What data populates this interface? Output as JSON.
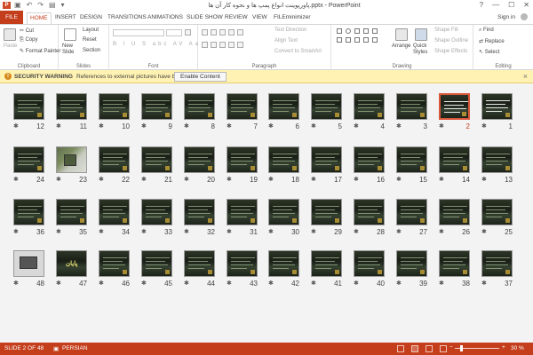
{
  "window": {
    "title": "پاورپوینت انواع پمپ ها و نحوه کار آن ها.pptx - PowerPoint",
    "app_icon": "P",
    "controls": [
      "?",
      "—",
      "☐",
      "✕"
    ]
  },
  "tabs": {
    "file": "FILE",
    "items": [
      "HOME",
      "INSERT",
      "DESIGN",
      "TRANSITIONS",
      "ANIMATIONS",
      "SLIDE SHOW",
      "REVIEW",
      "VIEW",
      "FILEminimizer"
    ],
    "active": "HOME",
    "signin": "Sign in"
  },
  "ribbon": {
    "clipboard": {
      "label": "Clipboard",
      "paste": "Paste",
      "cut": "Cut",
      "copy": "Copy",
      "format_painter": "Format Painter"
    },
    "slides": {
      "label": "Slides",
      "new_slide": "New Slide",
      "layout": "Layout",
      "reset": "Reset",
      "section": "Section"
    },
    "font": {
      "label": "Font",
      "buttons": [
        "B",
        "I",
        "U",
        "S",
        "abc",
        "AV",
        "Aa",
        "A"
      ]
    },
    "paragraph": {
      "label": "Paragraph",
      "text_direction": "Text Direction",
      "align_text": "Align Text",
      "convert_smartart": "Convert to SmartArt"
    },
    "drawing": {
      "label": "Drawing",
      "arrange": "Arrange",
      "quick_styles": "Quick Styles",
      "shape_fill": "Shape Fill",
      "shape_outline": "Shape Outline",
      "shape_effects": "Shape Effects"
    },
    "editing": {
      "label": "Editing",
      "find": "Find",
      "replace": "Replace",
      "select": "Select"
    }
  },
  "security": {
    "title": "SECURITY WARNING",
    "message": "References to external pictures have been blocked",
    "button": "Enable Content"
  },
  "slides": {
    "selected": 2,
    "rows": [
      [
        1,
        2,
        3,
        4,
        5,
        6,
        7,
        8,
        9,
        10,
        11,
        12
      ],
      [
        13,
        14,
        15,
        16,
        17,
        18,
        19,
        20,
        21,
        22,
        23,
        24
      ],
      [
        25,
        26,
        27,
        28,
        29,
        30,
        31,
        32,
        33,
        34,
        35,
        36
      ],
      [
        37,
        38,
        39,
        40,
        41,
        42,
        43,
        44,
        45,
        46,
        47,
        48
      ]
    ],
    "star": "✱",
    "photo_slides": [
      23
    ],
    "laptop_slides": [
      48
    ],
    "title_slides": [
      1,
      2,
      47
    ],
    "slide_47_text": "پایان"
  },
  "status": {
    "slide_info": "SLIDE 2 OF 48",
    "language": "PERSIAN",
    "zoom": "30 %",
    "zoom_minus": "−",
    "zoom_plus": "+"
  }
}
